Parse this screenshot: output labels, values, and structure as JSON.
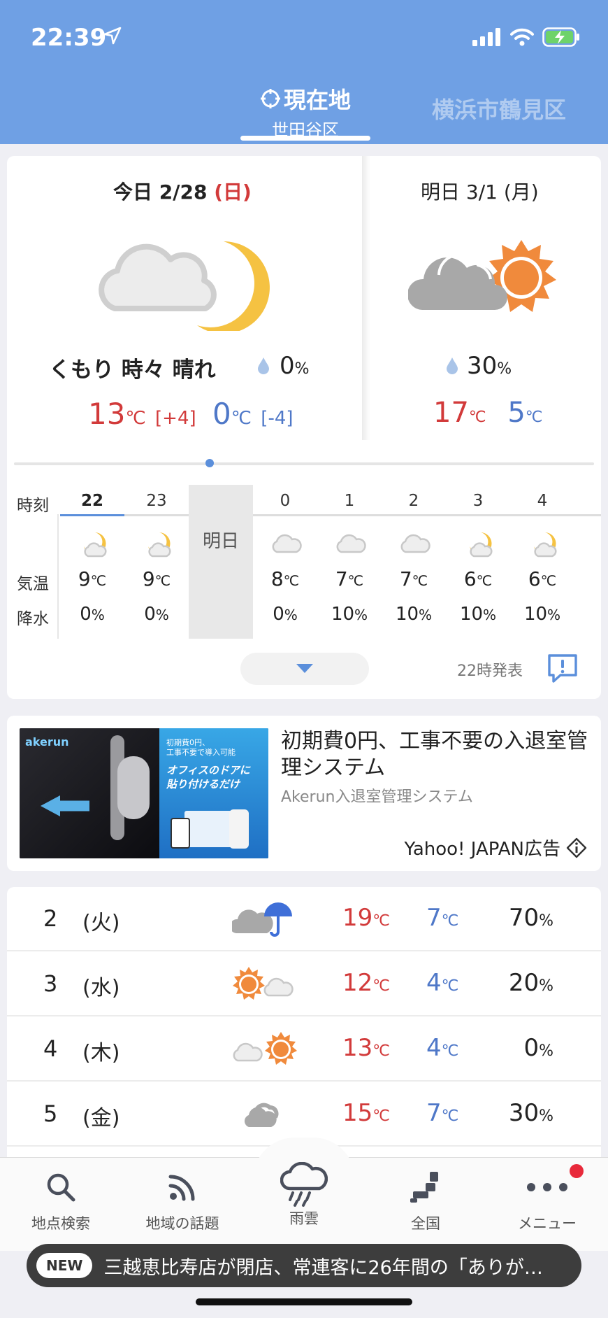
{
  "status_bar": {
    "time": "22:39"
  },
  "header": {
    "current_tab": {
      "title": "現在地",
      "subtitle": "世田谷区"
    },
    "other_tab": "横浜市鶴見区"
  },
  "today": {
    "label": "今日 2/28",
    "weekday": "(日)",
    "condition": "くもり 時々 晴れ",
    "precip": "0",
    "precip_unit": "%",
    "high": "13",
    "high_diff": "[+4]",
    "low": "0",
    "low_diff": "[-4]",
    "temp_unit": "℃"
  },
  "tomorrow": {
    "label": "明日 3/1 (月)",
    "precip": "30",
    "precip_unit": "%",
    "high": "17",
    "low": "5",
    "temp_unit": "℃"
  },
  "hourly": {
    "row_labels": {
      "time": "時刻",
      "temp": "気温",
      "rain": "降水"
    },
    "tomorrow_marker": "明日",
    "hours": [
      {
        "time": "22",
        "icon": "moon-cloud-icon",
        "temp": "9",
        "rain": "0"
      },
      {
        "time": "23",
        "icon": "moon-cloud-icon",
        "temp": "9",
        "rain": "0"
      },
      {
        "time": "0",
        "icon": "cloud-icon",
        "temp": "8",
        "rain": "0"
      },
      {
        "time": "1",
        "icon": "cloud-icon",
        "temp": "7",
        "rain": "10"
      },
      {
        "time": "2",
        "icon": "cloud-icon",
        "temp": "7",
        "rain": "10"
      },
      {
        "time": "3",
        "icon": "moon-cloud-icon",
        "temp": "6",
        "rain": "10"
      },
      {
        "time": "4",
        "icon": "moon-cloud-icon",
        "temp": "6",
        "rain": "10"
      }
    ],
    "temp_unit": "℃",
    "rain_unit": "%",
    "release": "22時発表"
  },
  "ad": {
    "brand": "akerun",
    "img_line1": "初期費0円、",
    "img_line2": "工事不要で導入可能",
    "img_line3": "オフィスのドアに",
    "img_line4": "貼り付けるだけ",
    "title": "初期費0円、工事不要の入退室管理システム",
    "subtitle": "Akerun入退室管理システム",
    "sponsor": "Yahoo! JAPAN広告"
  },
  "weekly": [
    {
      "day": "2",
      "weekday": "(火)",
      "icon": "cloud-umbrella-icon",
      "high": "19",
      "low": "7",
      "rain": "70"
    },
    {
      "day": "3",
      "weekday": "(水)",
      "icon": "sun-cloud-icon",
      "high": "12",
      "low": "4",
      "rain": "20"
    },
    {
      "day": "4",
      "weekday": "(木)",
      "icon": "cloud-sun-icon",
      "high": "13",
      "low": "4",
      "rain": "0"
    },
    {
      "day": "5",
      "weekday": "(金)",
      "icon": "cloud-icon",
      "high": "15",
      "low": "7",
      "rain": "30"
    }
  ],
  "weekly_units": {
    "temp": "℃",
    "rain": "%"
  },
  "nav": {
    "search": "地点検索",
    "topics": "地域の話題",
    "rain_cloud": "雨雲",
    "national": "全国",
    "menu": "メニュー"
  },
  "ticker": {
    "badge": "NEW",
    "text": "三越恵比寿店が閉店、常連客に26年間の「ありが…"
  },
  "colors": {
    "header": "#6fa0e4",
    "hot": "#d23a3a",
    "cold": "#4f78c8",
    "sun": "#f08a3c",
    "moon": "#f5c242"
  }
}
